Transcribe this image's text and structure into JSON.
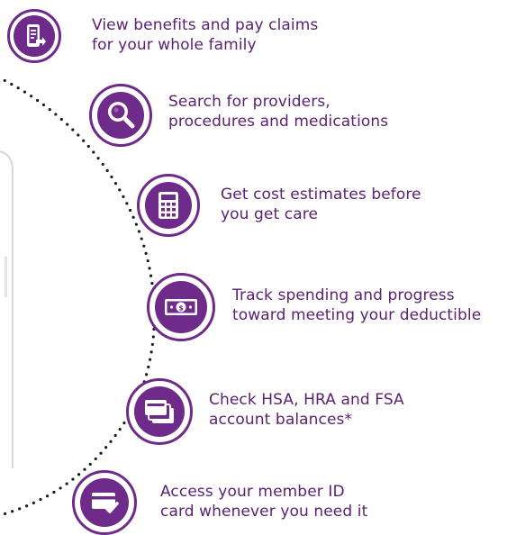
{
  "brand": {
    "accent": "#6f2b8a",
    "text_color": "#5b1f73",
    "background": "#ffffff"
  },
  "features": [
    {
      "icon": "mobile-document-icon",
      "lines": [
        "View benefits and pay claims",
        "for your whole family"
      ]
    },
    {
      "icon": "magnifier-icon",
      "lines": [
        "Search for providers,",
        "procedures and medications"
      ]
    },
    {
      "icon": "calculator-icon",
      "lines": [
        "Get cost estimates before",
        "you get care"
      ]
    },
    {
      "icon": "dollar-bill-icon",
      "lines": [
        "Track spending and progress",
        "toward meeting your deductible"
      ]
    },
    {
      "icon": "stacked-cards-icon",
      "lines": [
        "Check HSA, HRA and FSA",
        "account balances*"
      ]
    },
    {
      "icon": "id-card-check-icon",
      "lines": [
        "Access your member ID",
        "card whenever you need it"
      ]
    }
  ]
}
